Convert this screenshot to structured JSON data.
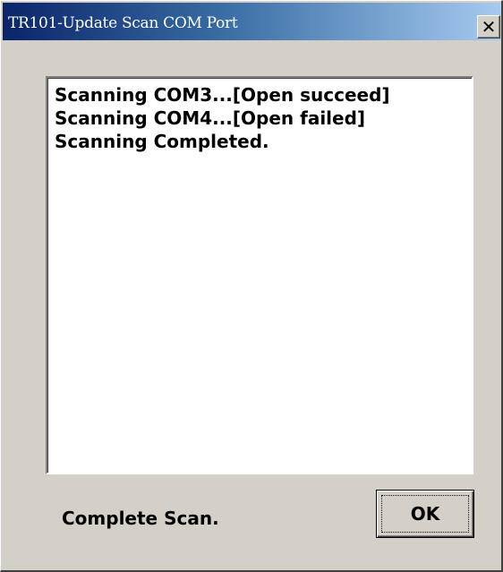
{
  "window": {
    "title": "TR101-Update Scan COM Port",
    "close_glyph": "✕",
    "close_icon": "close-icon"
  },
  "log": {
    "lines": [
      "Scanning COM3...[Open succeed]",
      "Scanning COM4...[Open failed]",
      "Scanning Completed."
    ]
  },
  "footer": {
    "status": "Complete Scan.",
    "ok_label": "OK"
  },
  "colors": {
    "titlebar_start": "#0a246a",
    "titlebar_end": "#a6caf0",
    "face": "#d4d0c8"
  }
}
